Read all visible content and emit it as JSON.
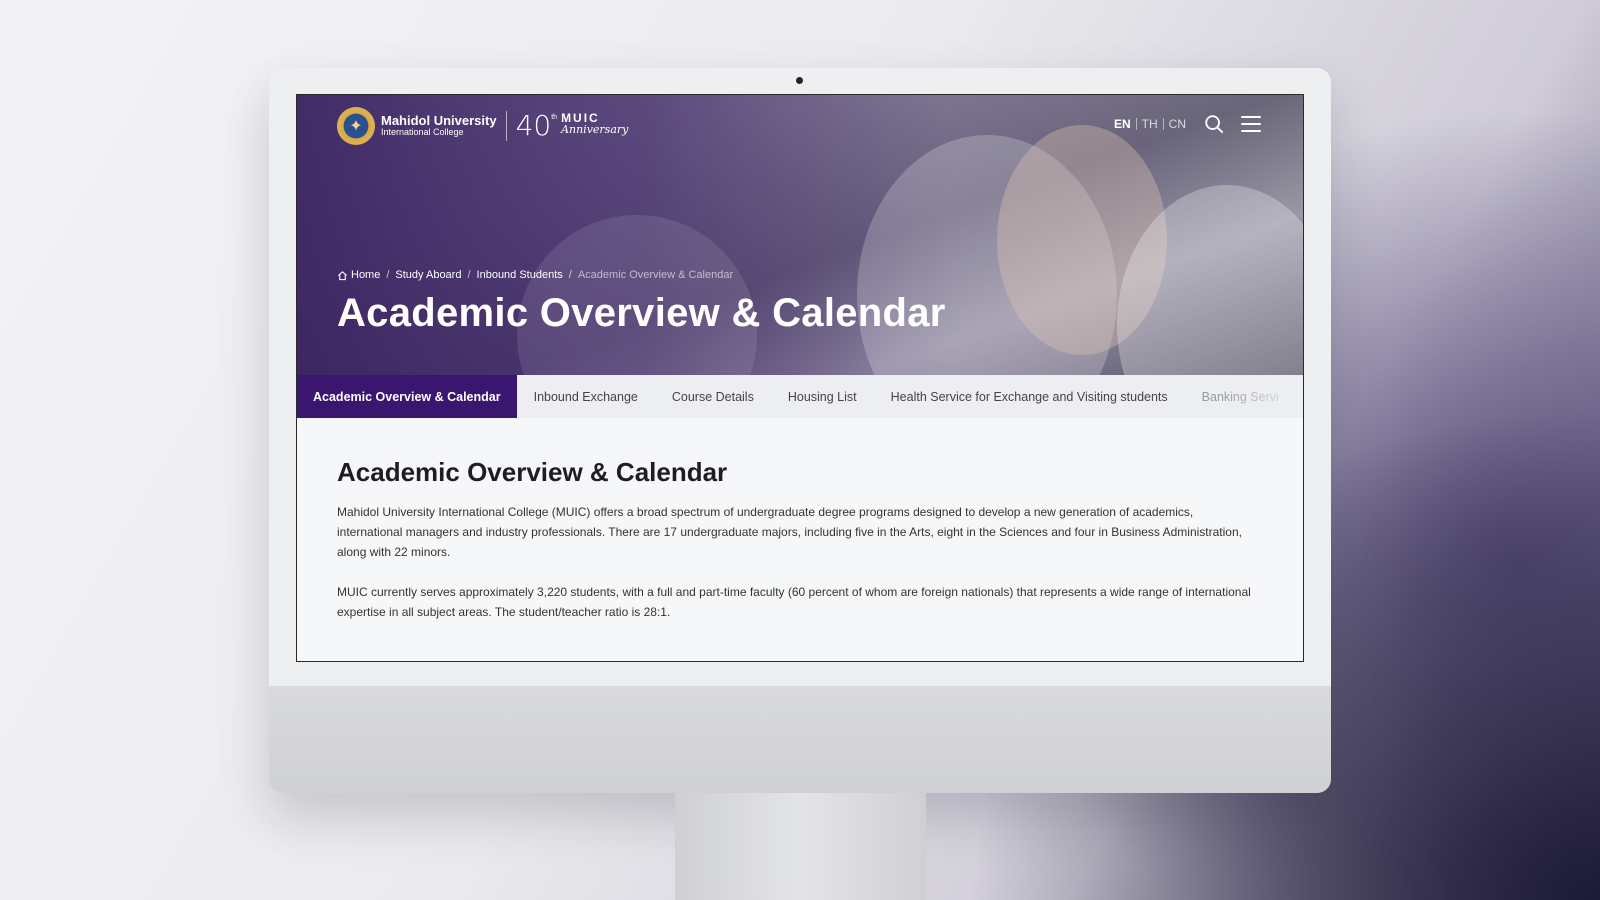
{
  "header": {
    "logo_name": "Mahidol University",
    "logo_sub": "International College",
    "anniv_num": "40",
    "anniv_sup": "th",
    "anniv_muic": "MUIC",
    "anniv_word": "Anniversary",
    "languages": [
      "EN",
      "TH",
      "CN"
    ],
    "active_language": "EN"
  },
  "breadcrumb": {
    "items": [
      "Home",
      "Study Aboard",
      "Inbound Students"
    ],
    "current": "Academic Overview & Calendar"
  },
  "hero": {
    "title": "Academic Overview & Calendar"
  },
  "tabs": [
    {
      "label": "Academic Overview & Calendar",
      "active": true
    },
    {
      "label": "Inbound Exchange"
    },
    {
      "label": "Course Details"
    },
    {
      "label": "Housing List"
    },
    {
      "label": "Health Service for Exchange and Visiting students"
    },
    {
      "label": "Banking Servi"
    }
  ],
  "content": {
    "heading": "Academic Overview & Calendar",
    "paragraphs": [
      "Mahidol University International College (MUIC) offers a broad spectrum of undergraduate degree programs designed to develop a new generation of academics, international managers and industry professionals. There are 17 undergraduate majors, including five in the Arts, eight in the Sciences and four in Business Administration, along with 22 minors.",
      "MUIC currently serves approximately 3,220 students, with a full and part-time faculty (60 percent of whom are foreign nationals) that represents a wide range of international expertise in all subject areas. The student/teacher ratio is 28:1."
    ]
  },
  "colors": {
    "accent": "#3a1670",
    "tab_bg": "#eceef2"
  }
}
